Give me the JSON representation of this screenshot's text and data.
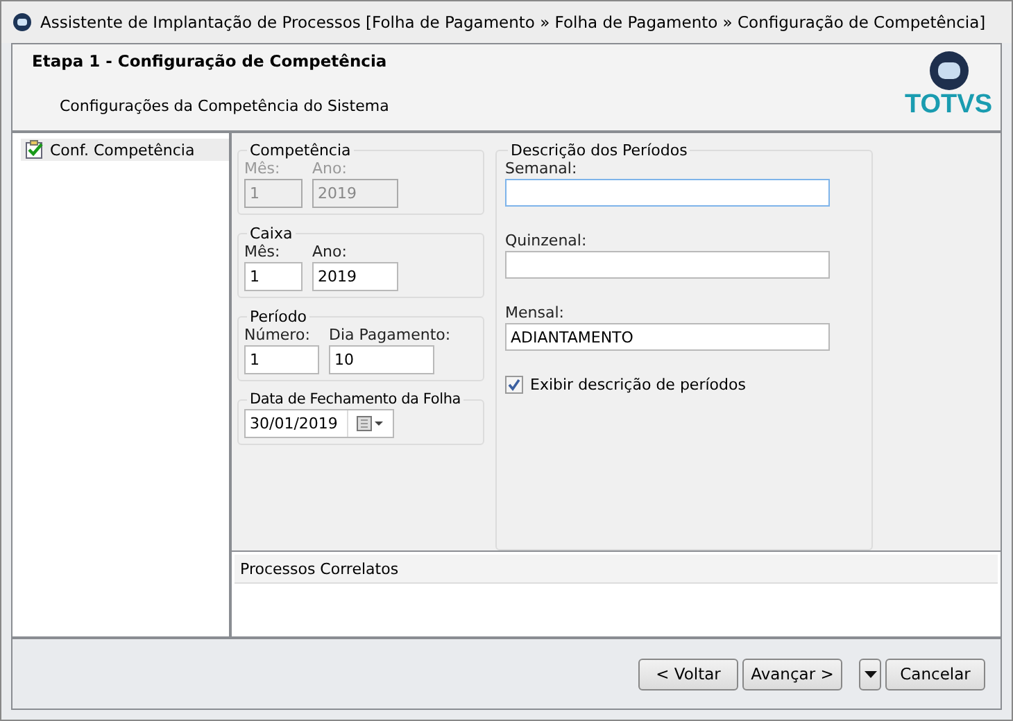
{
  "window": {
    "title": "Assistente de Implantação de Processos [Folha de Pagamento » Folha de Pagamento » Configuração de Competência]"
  },
  "header": {
    "title": "Etapa 1 - Configuração de Competência",
    "subtitle": "Configurações da Competência do Sistema",
    "logo_text": "TOTVS"
  },
  "tree": {
    "items": [
      {
        "label": "Conf. Competência",
        "selected": true
      }
    ]
  },
  "groups": [
    {
      "legend": "Competência",
      "fields": [
        {
          "label": "Mês:",
          "value": "1",
          "disabled": true
        },
        {
          "label": "Ano:",
          "value": "2019",
          "disabled": true
        }
      ]
    },
    {
      "legend": "Caixa",
      "fields": [
        {
          "label": "Mês:",
          "value": "1",
          "disabled": false
        },
        {
          "label": "Ano:",
          "value": "2019",
          "disabled": false
        }
      ]
    },
    {
      "legend": "Período",
      "fields": [
        {
          "label": "Número:",
          "value": "1",
          "disabled": false
        },
        {
          "label": "Dia Pagamento:",
          "value": "10",
          "disabled": false
        }
      ]
    }
  ],
  "closing_date": {
    "legend": "Data de Fechamento da Folha",
    "value": "30/01/2019"
  },
  "descriptions": {
    "legend": "Descrição dos Períodos",
    "fields": [
      {
        "label": "Semanal:",
        "focused": true
      },
      {
        "label": "Quinzenal:",
        "focused": false
      },
      {
        "label": "Mensal:",
        "value": "ADIANTAMENTO",
        "focused": false
      }
    ],
    "checkbox": {
      "label": "Exibir descrição de períodos",
      "checked": true
    }
  },
  "related": {
    "title": "Processos Correlatos"
  },
  "buttons": [
    {
      "label": "< Voltar",
      "kind": "button"
    },
    {
      "label": "Avançar >",
      "kind": "button"
    },
    {
      "kind": "dropdown"
    },
    {
      "label": "Cancelar",
      "kind": "button"
    }
  ]
}
